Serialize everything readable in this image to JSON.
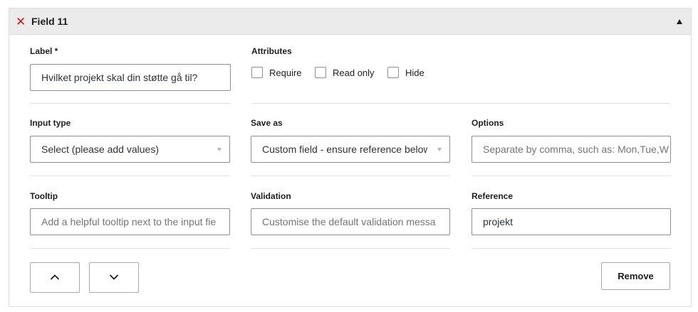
{
  "field": {
    "title": "Field 11",
    "label_heading": "Label *",
    "label_value": "Hvilket projekt skal din støtte gå til?",
    "attributes_heading": "Attributes",
    "attributes": [
      {
        "label": "Require",
        "checked": false
      },
      {
        "label": "Read only",
        "checked": false
      },
      {
        "label": "Hide",
        "checked": false
      }
    ],
    "input_type_heading": "Input type",
    "input_type_value": "Select (please add values)",
    "save_as_heading": "Save as",
    "save_as_value": "Custom field - ensure reference below",
    "options_heading": "Options",
    "options_placeholder": "Separate by comma, such as: Mon,Tue,W",
    "tooltip_heading": "Tooltip",
    "tooltip_placeholder": "Add a helpful tooltip next to the input fie",
    "validation_heading": "Validation",
    "validation_placeholder": "Customise the default validation messa",
    "reference_heading": "Reference",
    "reference_value": "projekt",
    "remove_label": "Remove"
  },
  "icons": {
    "close": "close-icon",
    "collapse": "caret-up-icon",
    "move_up": "chevron-up-icon",
    "move_down": "chevron-down-icon",
    "select_caret": "caret-down-icon"
  },
  "colors": {
    "close_red": "#cc1818",
    "header_bg": "#ebebeb",
    "border": "#8c8f94"
  }
}
